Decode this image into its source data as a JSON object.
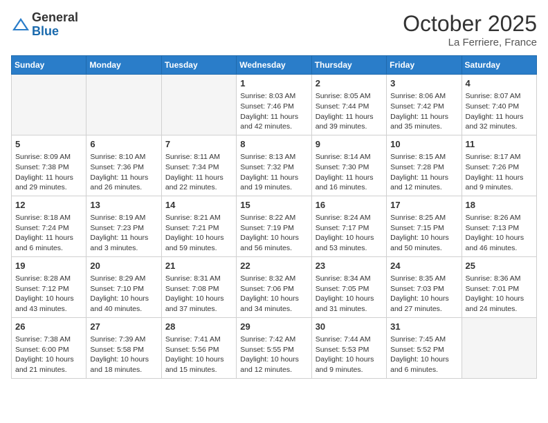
{
  "header": {
    "logo_general": "General",
    "logo_blue": "Blue",
    "month_title": "October 2025",
    "location": "La Ferriere, France"
  },
  "weekdays": [
    "Sunday",
    "Monday",
    "Tuesday",
    "Wednesday",
    "Thursday",
    "Friday",
    "Saturday"
  ],
  "weeks": [
    [
      {
        "day": "",
        "info": ""
      },
      {
        "day": "",
        "info": ""
      },
      {
        "day": "",
        "info": ""
      },
      {
        "day": "1",
        "info": "Sunrise: 8:03 AM\nSunset: 7:46 PM\nDaylight: 11 hours\nand 42 minutes."
      },
      {
        "day": "2",
        "info": "Sunrise: 8:05 AM\nSunset: 7:44 PM\nDaylight: 11 hours\nand 39 minutes."
      },
      {
        "day": "3",
        "info": "Sunrise: 8:06 AM\nSunset: 7:42 PM\nDaylight: 11 hours\nand 35 minutes."
      },
      {
        "day": "4",
        "info": "Sunrise: 8:07 AM\nSunset: 7:40 PM\nDaylight: 11 hours\nand 32 minutes."
      }
    ],
    [
      {
        "day": "5",
        "info": "Sunrise: 8:09 AM\nSunset: 7:38 PM\nDaylight: 11 hours\nand 29 minutes."
      },
      {
        "day": "6",
        "info": "Sunrise: 8:10 AM\nSunset: 7:36 PM\nDaylight: 11 hours\nand 26 minutes."
      },
      {
        "day": "7",
        "info": "Sunrise: 8:11 AM\nSunset: 7:34 PM\nDaylight: 11 hours\nand 22 minutes."
      },
      {
        "day": "8",
        "info": "Sunrise: 8:13 AM\nSunset: 7:32 PM\nDaylight: 11 hours\nand 19 minutes."
      },
      {
        "day": "9",
        "info": "Sunrise: 8:14 AM\nSunset: 7:30 PM\nDaylight: 11 hours\nand 16 minutes."
      },
      {
        "day": "10",
        "info": "Sunrise: 8:15 AM\nSunset: 7:28 PM\nDaylight: 11 hours\nand 12 minutes."
      },
      {
        "day": "11",
        "info": "Sunrise: 8:17 AM\nSunset: 7:26 PM\nDaylight: 11 hours\nand 9 minutes."
      }
    ],
    [
      {
        "day": "12",
        "info": "Sunrise: 8:18 AM\nSunset: 7:24 PM\nDaylight: 11 hours\nand 6 minutes."
      },
      {
        "day": "13",
        "info": "Sunrise: 8:19 AM\nSunset: 7:23 PM\nDaylight: 11 hours\nand 3 minutes."
      },
      {
        "day": "14",
        "info": "Sunrise: 8:21 AM\nSunset: 7:21 PM\nDaylight: 10 hours\nand 59 minutes."
      },
      {
        "day": "15",
        "info": "Sunrise: 8:22 AM\nSunset: 7:19 PM\nDaylight: 10 hours\nand 56 minutes."
      },
      {
        "day": "16",
        "info": "Sunrise: 8:24 AM\nSunset: 7:17 PM\nDaylight: 10 hours\nand 53 minutes."
      },
      {
        "day": "17",
        "info": "Sunrise: 8:25 AM\nSunset: 7:15 PM\nDaylight: 10 hours\nand 50 minutes."
      },
      {
        "day": "18",
        "info": "Sunrise: 8:26 AM\nSunset: 7:13 PM\nDaylight: 10 hours\nand 46 minutes."
      }
    ],
    [
      {
        "day": "19",
        "info": "Sunrise: 8:28 AM\nSunset: 7:12 PM\nDaylight: 10 hours\nand 43 minutes."
      },
      {
        "day": "20",
        "info": "Sunrise: 8:29 AM\nSunset: 7:10 PM\nDaylight: 10 hours\nand 40 minutes."
      },
      {
        "day": "21",
        "info": "Sunrise: 8:31 AM\nSunset: 7:08 PM\nDaylight: 10 hours\nand 37 minutes."
      },
      {
        "day": "22",
        "info": "Sunrise: 8:32 AM\nSunset: 7:06 PM\nDaylight: 10 hours\nand 34 minutes."
      },
      {
        "day": "23",
        "info": "Sunrise: 8:34 AM\nSunset: 7:05 PM\nDaylight: 10 hours\nand 31 minutes."
      },
      {
        "day": "24",
        "info": "Sunrise: 8:35 AM\nSunset: 7:03 PM\nDaylight: 10 hours\nand 27 minutes."
      },
      {
        "day": "25",
        "info": "Sunrise: 8:36 AM\nSunset: 7:01 PM\nDaylight: 10 hours\nand 24 minutes."
      }
    ],
    [
      {
        "day": "26",
        "info": "Sunrise: 7:38 AM\nSunset: 6:00 PM\nDaylight: 10 hours\nand 21 minutes."
      },
      {
        "day": "27",
        "info": "Sunrise: 7:39 AM\nSunset: 5:58 PM\nDaylight: 10 hours\nand 18 minutes."
      },
      {
        "day": "28",
        "info": "Sunrise: 7:41 AM\nSunset: 5:56 PM\nDaylight: 10 hours\nand 15 minutes."
      },
      {
        "day": "29",
        "info": "Sunrise: 7:42 AM\nSunset: 5:55 PM\nDaylight: 10 hours\nand 12 minutes."
      },
      {
        "day": "30",
        "info": "Sunrise: 7:44 AM\nSunset: 5:53 PM\nDaylight: 10 hours\nand 9 minutes."
      },
      {
        "day": "31",
        "info": "Sunrise: 7:45 AM\nSunset: 5:52 PM\nDaylight: 10 hours\nand 6 minutes."
      },
      {
        "day": "",
        "info": ""
      }
    ]
  ]
}
